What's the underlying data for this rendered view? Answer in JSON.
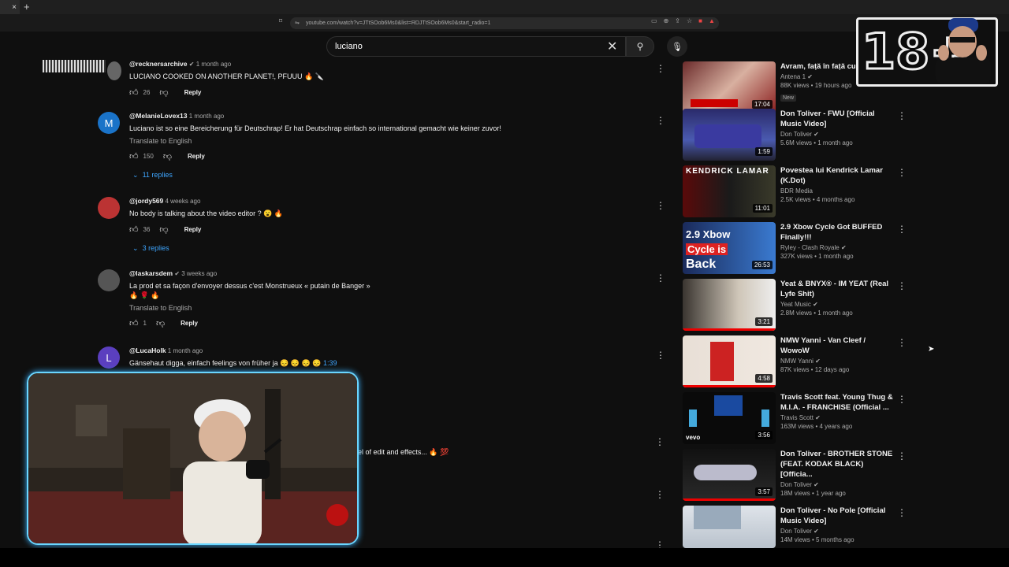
{
  "browser": {
    "tab_close": "×",
    "new_tab": "+",
    "url": "youtube.com/watch?v=JTtSOob6Ms0&list=RDJTtSOob6Ms0&start_radio=1"
  },
  "search": {
    "query": "luciano"
  },
  "comments": [
    {
      "user": "@recknersarchive",
      "time": "1 month ago",
      "text": "LUCIANO COOKED ON ANOTHER PLANET!, PFUUU 🔥 🔪",
      "likes": "26",
      "reply": "Reply"
    },
    {
      "user": "@MelanieLovex13",
      "time": "1 month ago",
      "avatar_letter": "M",
      "text": "Luciano ist so eine Bereicherung für Deutschrap! Er hat Deutschrap einfach so international gemacht wie keiner zuvor!",
      "translate": "Translate to English",
      "likes": "150",
      "reply": "Reply",
      "replies": "11 replies"
    },
    {
      "user": "@jordy569",
      "time": "4 weeks ago",
      "text": "No body is talking about the video editor ? 😮 🔥",
      "likes": "36",
      "reply": "Reply",
      "replies": "3 replies"
    },
    {
      "user": "@laskarsdem",
      "time": "3 weeks ago",
      "text": "La prod et sa façon d'envoyer dessus c'est Monstrueux « putain de Banger »",
      "text2": "🔥 🌹 🔥",
      "translate": "Translate to English",
      "likes": "1",
      "reply": "Reply"
    },
    {
      "user": "@LucaHolk",
      "time": "1 month ago",
      "avatar_letter": "L",
      "text": "Gänsehaut digga, einfach feelings von früher ja 😔 😔 😔 😔",
      "timestamp": "1:39"
    }
  ],
  "hidden_comment_fragment": "el of edit and effects... 🔥 💯",
  "sidebar": [
    {
      "title": "Avram, față în față cu",
      "channel": "Antena 1",
      "meta": "88K views • 19 hours ago",
      "badge": "New",
      "duration": "17:04"
    },
    {
      "title": "Don Toliver - FWU [Official Music Video]",
      "channel": "Don Toliver",
      "meta": "5.6M views • 1 month ago",
      "duration": "1:59"
    },
    {
      "title": "Povestea lui Kendrick Lamar (K.Dot)",
      "channel": "BDR Media",
      "meta": "2.5K views • 4 months ago",
      "duration": "11:01"
    },
    {
      "title": "2.9 Xbow Cycle Got BUFFED Finally!!!",
      "channel": "Ryley - Clash Royale",
      "meta": "327K views • 1 month ago",
      "duration": "26:53"
    },
    {
      "title": "Yeat & BNYX® - IM YEAT (Real Lyfe Shit)",
      "channel": "Yeat Music",
      "meta": "2.8M views • 1 month ago",
      "duration": "3:21"
    },
    {
      "title": "NMW Yanni - Van Cleef / WowoW",
      "channel": "NMW Yanni",
      "meta": "87K views • 12 days ago",
      "duration": "4:58"
    },
    {
      "title": "Travis Scott feat. Young Thug & M.I.A. - FRANCHISE (Official ...",
      "channel": "Travis Scott",
      "meta": "163M views • 4 years ago",
      "duration": "3:56"
    },
    {
      "title": "Don Toliver - BROTHER STONE (FEAT. KODAK BLACK) [Officia...",
      "channel": "Don Toliver",
      "meta": "18M views • 1 year ago",
      "duration": "3:57"
    },
    {
      "title": "Don Toliver - No Pole [Official Music Video]",
      "channel": "Don Toliver",
      "meta": "14M views • 5 months ago",
      "duration": ""
    }
  ],
  "thumb_text": {
    "kendrick": "KENDRICK LAMAR",
    "xbow1": "2.9 Xbow",
    "xbow2": "Cycle is",
    "xbow3": "Back",
    "vevo": "vevo"
  },
  "overlay": {
    "age_badge": "18+"
  },
  "colors": {
    "background": "#0f0f0f",
    "link": "#3ea6ff",
    "progress": "#e00000",
    "cam_border": "#6ad6ff"
  }
}
